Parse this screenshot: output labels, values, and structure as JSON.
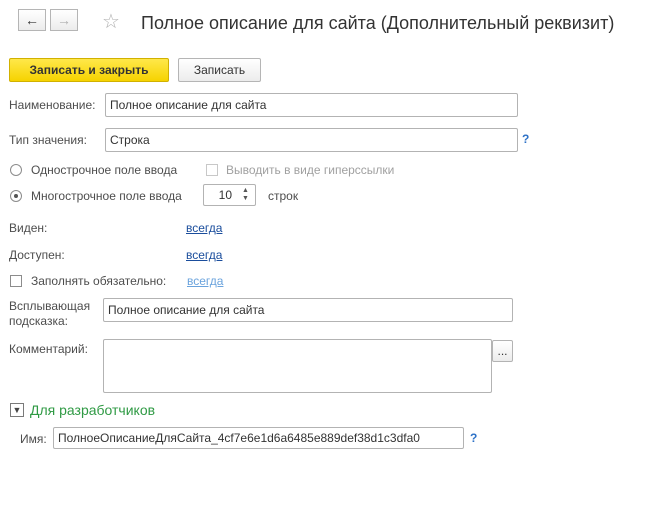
{
  "window": {
    "title": "Полное описание для сайта (Дополнительный реквизит)"
  },
  "nav": {
    "back_icon": "←",
    "forward_icon": "→",
    "star_icon": "☆"
  },
  "toolbar": {
    "save_close_label": "Записать и закрыть",
    "save_label": "Записать"
  },
  "form": {
    "name_label": "Наименование:",
    "name_value": "Полное описание для сайта",
    "type_label": "Тип значения:",
    "type_value": "Строка",
    "help_mark": "?",
    "single_line_label": "Однострочное поле ввода",
    "hyperlink_label": "Выводить в виде гиперссылки",
    "multi_line_label": "Многострочное поле ввода",
    "lines_value": "10",
    "lines_unit": "строк",
    "visible_label": "Виден:",
    "visible_value": "всегда",
    "available_label": "Доступен:",
    "available_value": "всегда",
    "required_label": "Заполнять обязательно:",
    "required_value": "всегда",
    "tooltip_label_line1": "Всплывающая",
    "tooltip_label_line2": "подсказка:",
    "tooltip_value": "Полное описание для сайта",
    "comment_label": "Комментарий:",
    "comment_value": "",
    "ellipsis": "..."
  },
  "developers": {
    "section_label": "Для разработчиков",
    "name_label": "Имя:",
    "name_value": "ПолноеОписаниеДляСайта_4cf7e6e1d6a6485e889def38d1c3dfa0",
    "help_mark": "?"
  },
  "colors": {
    "primary_button": "#f6d300",
    "link": "#1a4d9c",
    "section_green": "#2f9a44",
    "help": "#2e72c7"
  }
}
